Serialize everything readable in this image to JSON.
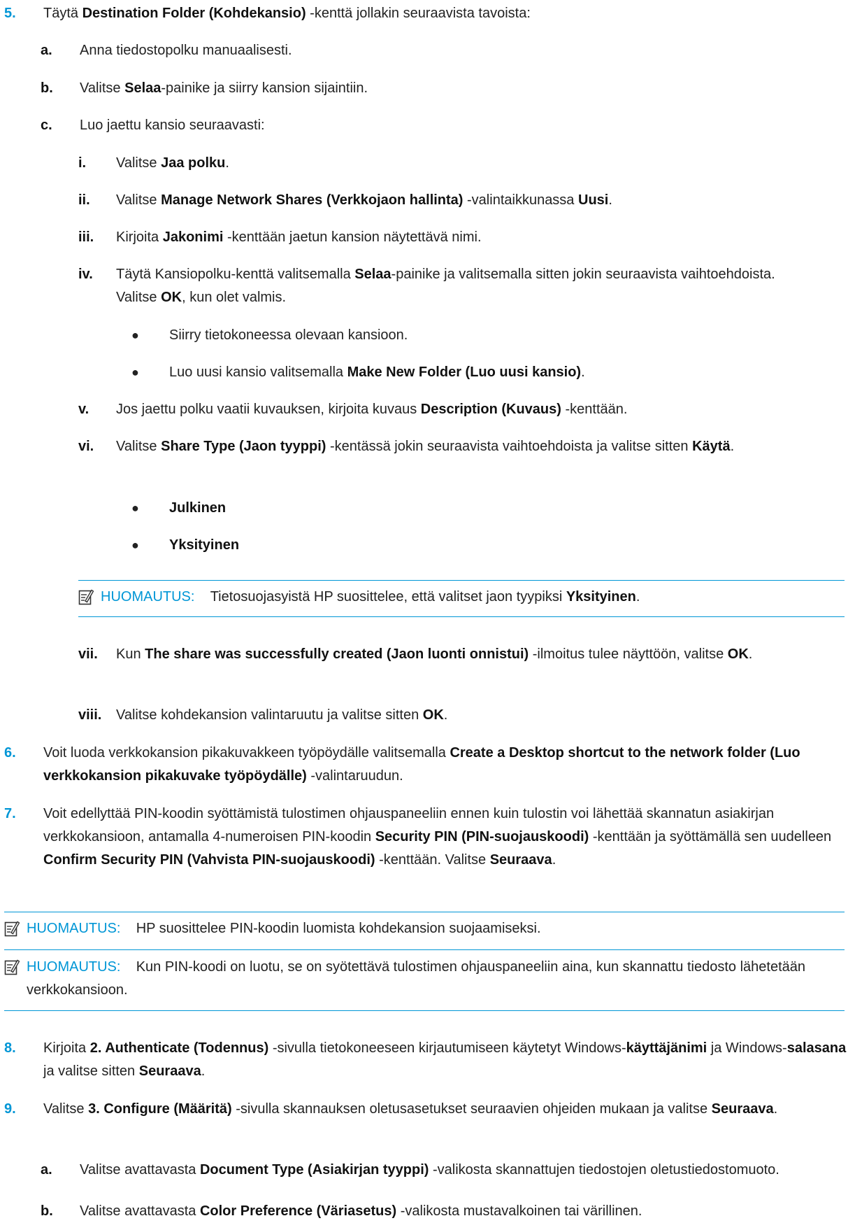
{
  "step5": {
    "label": "5.",
    "t1": "Täytä ",
    "b1": "Destination Folder (Kohdekansio)",
    "t2": " -kenttä jollakin seuraavista tavoista:",
    "a": {
      "label": "a.",
      "text": "Anna tiedostopolku manuaalisesti."
    },
    "b": {
      "label": "b.",
      "t1": "Valitse ",
      "b1": "Selaa",
      "t2": "-painike ja siirry kansion sijaintiin."
    },
    "c": {
      "label": "c.",
      "text": "Luo jaettu kansio seuraavasti:",
      "i": {
        "label": "i.",
        "t1": "Valitse ",
        "b1": "Jaa polku",
        "t2": "."
      },
      "ii": {
        "label": "ii.",
        "t1": "Valitse ",
        "b1": "Manage Network Shares (Verkkojaon hallinta)",
        "t2": " -valintaikkunassa ",
        "b2": "Uusi",
        "t3": "."
      },
      "iii": {
        "label": "iii.",
        "t1": "Kirjoita ",
        "b1": "Jakonimi",
        "t2": " -kenttään jaetun kansion näytettävä nimi."
      },
      "iv": {
        "label": "iv.",
        "t1": "Täytä Kansiopolku-kenttä valitsemalla ",
        "b1": "Selaa",
        "t2": "-painike ja valitsemalla sitten jokin seuraavista vaihtoehdoista. Valitse ",
        "b2": "OK",
        "t3": ", kun olet valmis.",
        "bullet1": "Siirry tietokoneessa olevaan kansioon.",
        "bullet2": {
          "t1": "Luo uusi kansio valitsemalla ",
          "b1": "Make New Folder (Luo uusi kansio)",
          "t2": "."
        }
      },
      "v": {
        "label": "v.",
        "t1": "Jos jaettu polku vaatii kuvauksen, kirjoita kuvaus ",
        "b1": "Description (Kuvaus)",
        "t2": " -kenttään."
      },
      "vi": {
        "label": "vi.",
        "t1": "Valitse ",
        "b1": "Share Type (Jaon tyyppi)",
        "t2": " -kentässä jokin seuraavista vaihtoehdoista ja valitse sitten ",
        "b2": "Käytä",
        "t3": ".",
        "bullet1": "Julkinen",
        "bullet2": "Yksityinen",
        "note": {
          "label": "HUOMAUTUS:",
          "t1": "Tietosuojasyistä HP suosittelee, että valitset jaon tyypiksi ",
          "b1": "Yksityinen",
          "t2": "."
        }
      },
      "vii": {
        "label": "vii.",
        "t1": "Kun ",
        "b1": "The share was successfully created (Jaon luonti onnistui)",
        "t2": " -ilmoitus tulee näyttöön, valitse ",
        "b2": "OK",
        "t3": "."
      },
      "viii": {
        "label": "viii.",
        "t1": "Valitse kohdekansion valintaruutu ja valitse sitten ",
        "b1": "OK",
        "t2": "."
      }
    }
  },
  "step6": {
    "label": "6.",
    "t1": "Voit luoda verkkokansion pikakuvakkeen työpöydälle valitsemalla ",
    "b1": "Create a Desktop shortcut to the network folder (Luo verkkokansion pikakuvake työpöydälle)",
    "t2": " -valintaruudun."
  },
  "step7": {
    "label": "7.",
    "t1": "Voit edellyttää PIN-koodin syöttämistä tulostimen ohjauspaneeliin ennen kuin tulostin voi lähettää skannatun asiakirjan verkkokansioon, antamalla 4-numeroisen PIN-koodin ",
    "b1": "Security PIN (PIN-suojauskoodi)",
    "t2": " -kenttään ja syöttämällä sen uudelleen ",
    "b2": "Confirm Security PIN (Vahvista PIN-suojauskoodi)",
    "t3": " -kenttään. Valitse ",
    "b3": "Seuraava",
    "t4": "."
  },
  "note1": {
    "label": "HUOMAUTUS:",
    "text": "HP suosittelee PIN-koodin luomista kohdekansion suojaamiseksi."
  },
  "note2": {
    "label": "HUOMAUTUS:",
    "text": "Kun PIN-koodi on luotu, se on syötettävä tulostimen ohjauspaneeliin aina, kun skannattu tiedosto lähetetään verkkokansioon."
  },
  "step8": {
    "label": "8.",
    "t1": "Kirjoita ",
    "b1": "2. Authenticate (Todennus)",
    "t2": " -sivulla tietokoneeseen kirjautumiseen käytetyt Windows-",
    "b2": "käyttäjänimi",
    "t3": " ja Windows-",
    "b3": "salasana",
    "t4": " ja valitse sitten ",
    "b4": "Seuraava",
    "t5": "."
  },
  "step9": {
    "label": "9.",
    "t1": "Valitse ",
    "b1": "3. Configure (Määritä)",
    "t2": " -sivulla skannauksen oletusasetukset seuraavien ohjeiden mukaan ja valitse ",
    "b2": "Seuraava",
    "t3": ".",
    "a": {
      "label": "a.",
      "t1": "Valitse avattavasta ",
      "b1": "Document Type (Asiakirjan tyyppi)",
      "t2": " -valikosta skannattujen tiedostojen oletustiedostomuoto."
    },
    "b": {
      "label": "b.",
      "t1": "Valitse avattavasta ",
      "b1": "Color Preference (Väriasetus)",
      "t2": " -valikosta mustavalkoinen tai värillinen."
    }
  },
  "colors": {
    "accent": "#0096d6",
    "text": "#222222"
  },
  "icons": {
    "note": "note-pencil-icon"
  }
}
